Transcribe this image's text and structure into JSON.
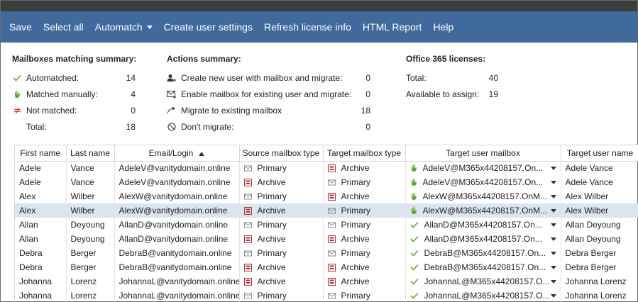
{
  "toolbar": {
    "save": "Save",
    "select_all": "Select all",
    "automatch": "Automatch",
    "create_user_settings": "Create user settings",
    "refresh_license": "Refresh license info",
    "html_report": "HTML Report",
    "help": "Help"
  },
  "matching_summary": {
    "title": "Mailboxes matching summary:",
    "rows": [
      {
        "label": "Automatched:",
        "value": "14",
        "icon": "check-icon"
      },
      {
        "label": "Matched manually:",
        "value": "4",
        "icon": "hand-icon"
      },
      {
        "label": "Not matched:",
        "value": "0",
        "icon": "not-equal-icon"
      },
      {
        "label": "Total:",
        "value": "18",
        "icon": ""
      }
    ]
  },
  "actions_summary": {
    "title": "Actions summary:",
    "rows": [
      {
        "label": "Create new user with mailbox and migrate:",
        "value": "0",
        "icon": "user-add-icon"
      },
      {
        "label": "Enable mailbox for existing user and migrate:",
        "value": "0",
        "icon": "mail-enable-icon"
      },
      {
        "label": "Migrate to existing mailbox",
        "value": "18",
        "icon": "migrate-arrow-icon"
      },
      {
        "label": "Don't migrate:",
        "value": "0",
        "icon": "block-icon"
      }
    ]
  },
  "licenses": {
    "title": "Office 365 licenses:",
    "rows": [
      {
        "label": "Total:",
        "value": "40"
      },
      {
        "label": "Available to assign:",
        "value": "19"
      }
    ]
  },
  "grid": {
    "columns": [
      "First name",
      "Last name",
      "Email/Login",
      "Source mailbox type",
      "Target mailbox type",
      "Target user mailbox",
      "Target user name"
    ],
    "sorted_column": "Email/Login",
    "rows": [
      {
        "first": "Adele",
        "last": "Vance",
        "email": "AdeleV@vanitydomain.online",
        "src": "Primary",
        "tgt": "Archive",
        "match": "hand",
        "tum": "AdeleV@M365x44208157.On...",
        "tun": "Adele Vance"
      },
      {
        "first": "Adele",
        "last": "Vance",
        "email": "AdeleV@vanitydomain.online",
        "src": "Archive",
        "tgt": "Primary",
        "match": "hand",
        "tum": "AdeleV@M365x44208157.On...",
        "tun": "Adele Vance"
      },
      {
        "first": "Alex",
        "last": "Wilber",
        "email": "AlexW@vanitydomain.online",
        "src": "Primary",
        "tgt": "Archive",
        "match": "hand",
        "tum": "AlexW@M365x44208157.OnM...",
        "tun": "Alex Wilber"
      },
      {
        "first": "Alex",
        "last": "Wilber",
        "email": "AlexW@vanitydomain.online",
        "src": "Archive",
        "tgt": "Primary",
        "match": "hand",
        "tum": "AlexW@M365x44208157.OnM...",
        "tun": "Alex Wilber"
      },
      {
        "first": "Allan",
        "last": "Deyoung",
        "email": "AllanD@vanitydomain.online",
        "src": "Primary",
        "tgt": "Primary",
        "match": "check",
        "tum": "AllanD@M365x44208157.On...",
        "tun": "Allan Deyoung"
      },
      {
        "first": "Allan",
        "last": "Deyoung",
        "email": "AllanD@vanitydomain.online",
        "src": "Archive",
        "tgt": "Archive",
        "match": "check",
        "tum": "AllanD@M365x44208157.On...",
        "tun": "Allan Deyoung"
      },
      {
        "first": "Debra",
        "last": "Berger",
        "email": "DebraB@vanitydomain.online",
        "src": "Primary",
        "tgt": "Primary",
        "match": "check",
        "tum": "DebraB@M365x44208157.On...",
        "tun": "Debra Berger"
      },
      {
        "first": "Debra",
        "last": "Berger",
        "email": "DebraB@vanitydomain.online",
        "src": "Archive",
        "tgt": "Archive",
        "match": "check",
        "tum": "DebraB@M365x44208157.On...",
        "tun": "Debra Berger"
      },
      {
        "first": "Johanna",
        "last": "Lorenz",
        "email": "JohannaL@vanitydomain.online",
        "src": "Archive",
        "tgt": "Archive",
        "match": "check",
        "tum": "JohannaL@M365x44208157.O...",
        "tun": "Johanna Lorenz"
      },
      {
        "first": "Johanna",
        "last": "Lorenz",
        "email": "JohannaL@vanitydomain.online",
        "src": "Primary",
        "tgt": "Primary",
        "match": "check",
        "tum": "JohannaL@M365x44208157.O...",
        "tun": "Johanna Lorenz"
      }
    ],
    "selected_row": 3
  },
  "colors": {
    "toolbar_bg": "#3f6a9b",
    "selected_row_bg": "#dce4ee",
    "check_green": "#5aab2e",
    "not_matched_red": "#d9363e",
    "archive_red": "#b5313a"
  }
}
